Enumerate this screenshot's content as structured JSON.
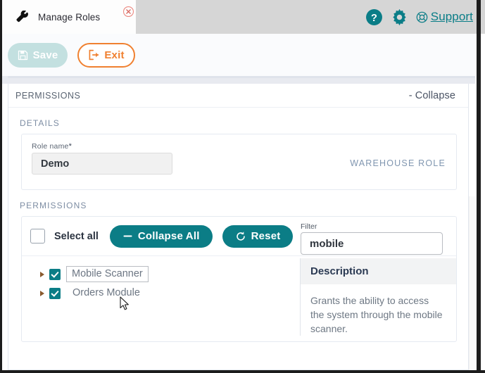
{
  "window": {
    "tab": {
      "title": "Manage Roles",
      "icon": "wrench-icon",
      "close_icon": "close-circle-icon"
    },
    "header": {
      "help_icon": "help-circle-icon",
      "settings_icon": "gear-icon",
      "support_icon": "lifebuoy-icon",
      "support_label": "Support"
    },
    "accent_teal": "#0b7d86",
    "accent_orange": "#f08030",
    "header_gray": "#d6d6d6"
  },
  "actionbar": {
    "save_label": "Save",
    "save_icon": "save-disk-icon",
    "save_disabled": true,
    "exit_label": "Exit",
    "exit_icon": "exit-door-icon"
  },
  "permissions_card": {
    "header_title": "PERMISSIONS",
    "collapse_label": "- Collapse"
  },
  "details": {
    "section_label": "DETAILS",
    "role_name_label": "Role name",
    "required_marker": "*",
    "role_name_value": "Demo",
    "role_name_placeholder": "",
    "role_type_tag": "WAREHOUSE ROLE"
  },
  "permissions": {
    "section_label": "PERMISSIONS",
    "select_all_label": "Select all",
    "select_all_checked": false,
    "collapse_all_label": "Collapse All",
    "collapse_all_icon": "minus-icon",
    "reset_label": "Reset",
    "reset_icon": "refresh-icon",
    "filter_label": "Filter",
    "filter_value": "mobile",
    "filter_placeholder": "",
    "tree": [
      {
        "label": "Mobile Scanner",
        "checked": true,
        "expanded": false,
        "focused": true
      },
      {
        "label": "Orders Module",
        "checked": true,
        "expanded": false,
        "focused": false
      }
    ],
    "description": {
      "title": "Description",
      "text": "Grants the ability to access the system through the mobile scanner."
    }
  }
}
